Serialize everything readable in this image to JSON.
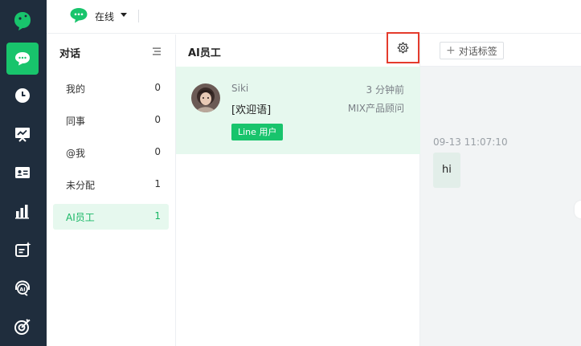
{
  "topbar": {
    "status_label": "在线"
  },
  "rail": {
    "items": [
      {
        "icon": "chat-bubble-icon",
        "active": true
      },
      {
        "icon": "clock-icon"
      },
      {
        "icon": "monitor-chart-icon"
      },
      {
        "icon": "contact-card-icon"
      },
      {
        "icon": "bar-chart-icon"
      },
      {
        "icon": "ai-spark-icon"
      },
      {
        "icon": "ai-headset-icon"
      },
      {
        "icon": "target-icon"
      }
    ]
  },
  "categories": {
    "title": "对话",
    "items": [
      {
        "label": "我的",
        "count": "0"
      },
      {
        "label": "同事",
        "count": "0"
      },
      {
        "label": "@我",
        "count": "0"
      },
      {
        "label": "未分配",
        "count": "1"
      },
      {
        "label": "AI员工",
        "count": "1",
        "active": true
      }
    ]
  },
  "list": {
    "title": "AI员工",
    "conversation": {
      "name": "Siki",
      "time": "3 分钟前",
      "message": "[欢迎语]",
      "agent": "MIX产品顾问",
      "tag": "Line 用户"
    }
  },
  "chat": {
    "tag_button": "对话标签",
    "message_time": "09-13 11:07:10",
    "message_text": "hi"
  },
  "colors": {
    "accent": "#18c46c",
    "rail_bg": "#1f2d3d",
    "highlight": "#e43b2c"
  }
}
